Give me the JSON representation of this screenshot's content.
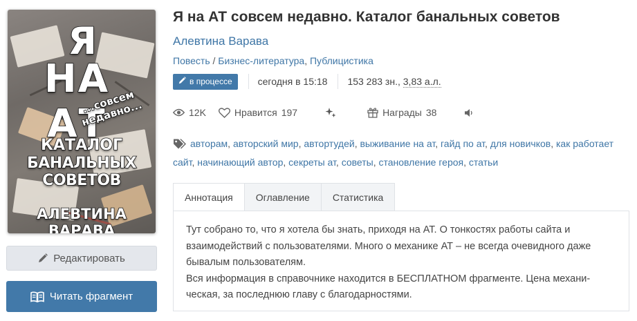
{
  "cover": {
    "line1": "Я",
    "line2": "НА АТ",
    "line3": "...совсем недавно...",
    "line4": "КАТАЛОГ",
    "line5": "БАНАЛЬНЫХ СОВЕТОВ",
    "author": "АЛЕВТИНА ВАРАВА"
  },
  "actions": {
    "edit_label": "Редактировать",
    "read_label": "Читать фрагмент"
  },
  "book": {
    "title": "Я на АТ совсем недавно. Каталог банальных советов",
    "author": "Алевтина Варава",
    "form": "Повесть",
    "genres": [
      "Бизнес-литература",
      "Публицистика"
    ],
    "status_badge": "в процессе",
    "updated": "сегодня в 15:18",
    "size_chars": "153 283 зн., ",
    "size_al": "3,83 а.л."
  },
  "stats": {
    "views": "12K",
    "likes_label": "Нравится",
    "likes_count": "197",
    "awards_label": "Награды",
    "awards_count": "38"
  },
  "tags": [
    "авторам",
    "авторский мир",
    "автортудей",
    "выживание на ат",
    "гайд по ат",
    "для новичков",
    "как работает сайт",
    "начинающий автор",
    "секреты ат",
    "советы",
    "становление героя",
    "статьи"
  ],
  "tabs": [
    "Аннотация",
    "Оглавление",
    "Статистика"
  ],
  "annotation": {
    "paragraph1": "Тут собрано то, что я хотела бы знать, приходя на АТ. О тонкостях работы сайта и взаимодействий с пользователями. Много о механике АТ – не всегда очевидного даже бывалым пользователям.",
    "paragraph2": "Вся информация в справочнике находится в БЕСПЛАТНОМ фрагменте. Цена механи­ческая, за последнюю главу с благодарностями."
  },
  "colors": {
    "link": "#3f76a6",
    "primary_button": "#4279a9",
    "secondary_button": "#e4e7ec"
  },
  "icons": [
    "pencil-icon",
    "open-book-icon",
    "eye-icon",
    "heart-icon",
    "sparkle-icon",
    "gift-icon",
    "speaker-icon",
    "tag-icon"
  ]
}
